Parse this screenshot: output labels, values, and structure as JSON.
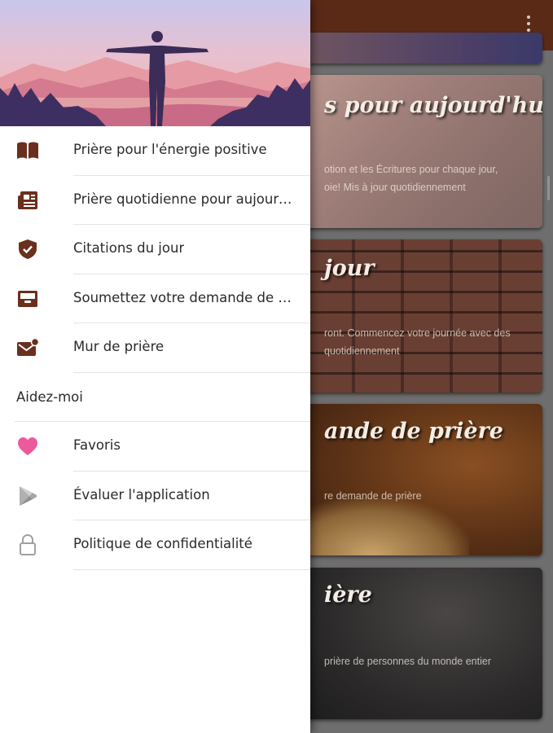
{
  "drawer": {
    "items": [
      {
        "label": "Prière pour l'énergie positive",
        "icon": "book-open-icon"
      },
      {
        "label": "Prière quotidienne pour aujourd'hui",
        "icon": "newspaper-icon"
      },
      {
        "label": "Citations du jour",
        "icon": "shield-check-icon"
      },
      {
        "label": "Soumettez votre demande de prière",
        "icon": "inbox-tray-icon"
      },
      {
        "label": "Mur de prière",
        "icon": "mail-notification-icon"
      }
    ],
    "section_title": "Aidez-moi",
    "help_items": [
      {
        "label": "Favoris",
        "icon": "heart-icon"
      },
      {
        "label": "Évaluer l'application",
        "icon": "play-store-icon"
      },
      {
        "label": "Politique de confidentialité",
        "icon": "lock-icon"
      }
    ],
    "colors": {
      "icon_brown": "#6b2f1e",
      "heart_pink": "#ec5a9b",
      "icon_grey": "#9e9e9e"
    }
  },
  "app_bar": {
    "color": "#5b2a17",
    "overflow_icon": "more-vert-icon"
  },
  "cards": [
    {
      "title": "s pour aujourd'hui",
      "desc_lines": [
        "otion et les Écritures pour chaque jour,",
        "oie! Mis à jour quotidiennement"
      ]
    },
    {
      "title": "jour",
      "desc_lines": [
        "ront. Commencez votre journée avec des",
        "quotidiennement"
      ]
    },
    {
      "title": "ande de prière",
      "desc_lines": [
        "re demande de prière"
      ]
    },
    {
      "title": "ière",
      "desc_lines": [
        "prière de personnes du monde entier"
      ]
    }
  ]
}
